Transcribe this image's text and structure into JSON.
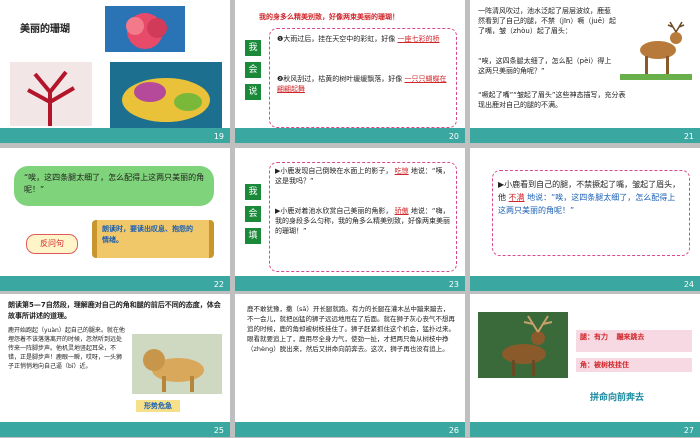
{
  "slides": [
    {
      "num": "19",
      "title": "美丽的珊瑚"
    },
    {
      "num": "20",
      "header": "我的身多么精美别致，好像两束美丽的珊瑚！",
      "verbs": [
        "我",
        "会",
        "说"
      ],
      "q1": "❶大雨过后，挂在天空中的彩虹，好像",
      "a1": "一座七彩的桥",
      "q2": "❷秋风刮过，枯黄的树叶缓缓飘落，好像",
      "a2": "一只只蝴蝶在翩翩起舞"
    },
    {
      "num": "21",
      "text1": "一阵清风吹过，池水泛起了层层波纹，鹿惹然看到了自己的腿，不禁（jīn）噘（juē）起了嘴，皱（zhòu）起了眉头：",
      "quote": "“唉，这四条腿太细了，怎么配（pèi）得上这两只美丽的角呢？”",
      "note": "“噘起了嘴”“皱起了眉头”这些神态描写，充分表现出鹿对自己的腿的不满。"
    },
    {
      "num": "22",
      "quote": "“唉，这四条腿太细了，怎么配得上这两只美丽的角呢！”",
      "tag": "反问句",
      "tip": "朗读时，要读出叹息、抱怨的情绪。"
    },
    {
      "num": "23",
      "verbs": [
        "我",
        "会",
        "填"
      ],
      "s1": "▶小鹿发现自己倒映在水面上的影子，",
      "w1": "吃惊",
      "s1b": "地说：“咦，这是我吗？”",
      "s2": "▶小鹿对着池水欣赏自己美丽的角影，",
      "w2": "骄傲",
      "s2b": "地说：“嗨，我的身段多么匀称，我的角多么精美别致，好像两束美丽的珊瑚！”"
    },
    {
      "num": "24",
      "text": "▶小鹿看到自己的腿，不禁撅起了嘴，皱起了眉头，他",
      "w": "不满",
      "text2": "地说：“唉，这四条腿太细了，怎么配得上这两只美丽的角呢！”"
    },
    {
      "num": "25",
      "header": "朗读第5—7自然段，理解鹿对自己的角和腿的前后不同的态度，体会故事所讲述的道理。",
      "body": "鹿开始跑起（yuàn）起自己的腿来。就在他埋怨着不该落落离开的时候，忽然听到远处传来一阵脚步声。他机灵地竖起耳朵，不错，正是脚步声！鹿眼一瞬，哎呀，一头狮子正悄悄地向自己逼（bī）近。",
      "tag": "形势危急"
    },
    {
      "num": "26",
      "body": "鹿不敢犹豫，撒（sā）开长腿就跑。有力的长腿在灌木丛中蹦来蹦去，不一会儿，就把凶猛的狮子远远地甩在了后面。就在狮子灰心丧气不想再追的时候，鹿的角却被树枝挂住了。狮子赶紧抓住这个机会，猛扑过来。眼看就要追上了，鹿用尽全身力气，使劲一扯，才把两只角从树枝中挣（zhèng）脱出来，然后又拼命向前奔去。这次，狮子再也没有追上。"
    },
    {
      "num": "27",
      "l1": "腿：有力",
      "l1b": "蹦来跳去",
      "l2": "角：被树枝挂住",
      "caption": "拼命向前奔去"
    }
  ]
}
